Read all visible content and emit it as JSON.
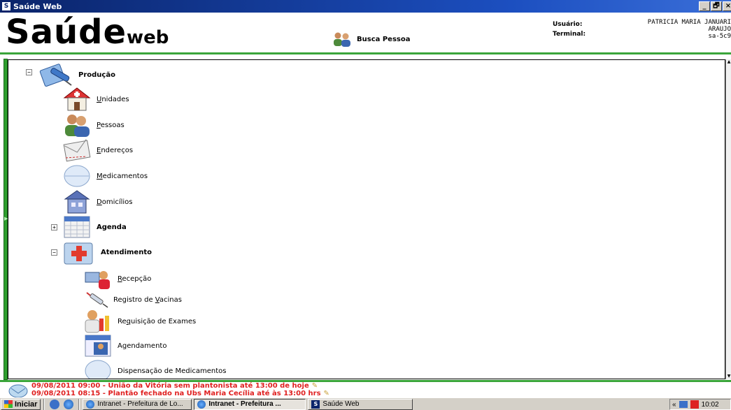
{
  "window": {
    "app_icon_text": "S",
    "title": "Saúde Web",
    "controls": [
      "_",
      "🗗",
      "×"
    ]
  },
  "header": {
    "logo_main": "Saúde",
    "logo_sub": "web",
    "busca_label": "Busca Pessoa",
    "usuario_label": "Usuário:",
    "terminal_label": "Terminal:",
    "user_name_line1": "PATRICIA MARIA JANUARI",
    "user_name_line2": "ARAUJO",
    "terminal_value": "sa-5c9"
  },
  "tree": {
    "root": {
      "label": "Produção",
      "expander": "−",
      "icon": "syringe-document-icon"
    },
    "items": [
      {
        "label": "Unidades",
        "accel": "U",
        "icon": "health-unit-house-icon"
      },
      {
        "label": "Pessoas",
        "accel": "P",
        "icon": "people-icon"
      },
      {
        "label": "Endereços",
        "accel": "E",
        "icon": "envelope-icon"
      },
      {
        "label": "Medicamentos",
        "accel": "M",
        "icon": "pill-icon"
      },
      {
        "label": "Domicílios",
        "accel": "D",
        "icon": "residence-icon"
      }
    ],
    "agenda": {
      "label": "Agenda",
      "expander": "+",
      "icon": "calendar-icon",
      "badge": "Agenda"
    },
    "atendimento": {
      "label": "Atendimento",
      "expander": "−",
      "icon": "medical-folder-icon"
    },
    "sub_items": [
      {
        "label": "Recepção",
        "accel": "R",
        "icon": "reception-icon"
      },
      {
        "label": "Registro de Vacinas",
        "accel": "V",
        "icon": "vaccine-icon"
      },
      {
        "label": "Requisição de Exames",
        "accel": "q",
        "icon": "exam-request-icon"
      },
      {
        "label": "Agendamento",
        "accel": "g",
        "icon": "appointment-icon",
        "badge": "Agenda"
      },
      {
        "label": "Dispensação de Medicamentos",
        "accel": "",
        "icon": "pill-icon"
      }
    ]
  },
  "news": {
    "line1": "09/08/2011 09:00 - União da Vitória sem plantonista até 13:00 de hoje",
    "line2": "09/08/2011 08:15 - Plantão fechado na Ubs Maria Cecília até às 13:00 hrs",
    "pen_glyph": "✎"
  },
  "taskbar": {
    "start_label": "Iniciar",
    "tasks": [
      {
        "label": "Intranet - Prefeitura de Lo...",
        "active": false
      },
      {
        "label": "Intranet - Prefeitura ...",
        "active": true
      },
      {
        "label": "Saúde Web",
        "active": false
      }
    ],
    "tray_arrows": "«",
    "clock": "10:02"
  },
  "colors": {
    "accent_green": "#3aa53a",
    "news_red": "#e02020",
    "title_blue": "#0a246a"
  }
}
